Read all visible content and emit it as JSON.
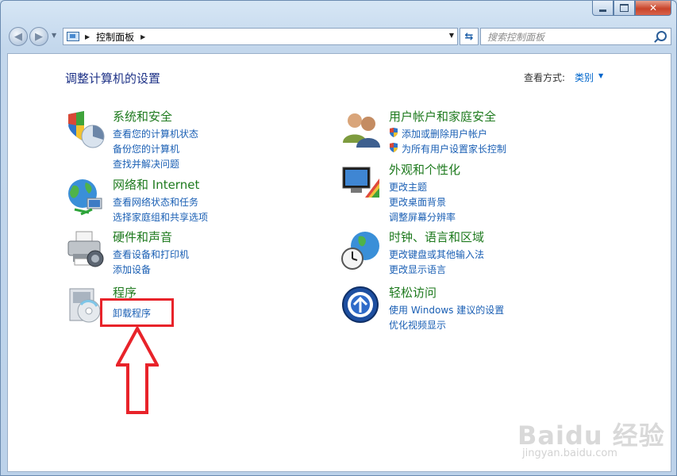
{
  "window": {
    "controls": {
      "minimize": "—",
      "maximize": "□",
      "close": "✕"
    }
  },
  "toolbar": {
    "breadcrumb": [
      "控制面板"
    ],
    "search_placeholder": "搜索控制面板"
  },
  "header": {
    "title": "调整计算机的设置",
    "view_by_label": "查看方式:",
    "view_by_value": "类别"
  },
  "categories": [
    {
      "title": "系统和安全",
      "links": [
        "查看您的计算机状态",
        "备份您的计算机",
        "查找并解决问题"
      ],
      "icon": "shield-icon"
    },
    {
      "title": "网络和 Internet",
      "links": [
        "查看网络状态和任务",
        "选择家庭组和共享选项"
      ],
      "icon": "globe-network-icon"
    },
    {
      "title": "硬件和声音",
      "links": [
        "查看设备和打印机",
        "添加设备"
      ],
      "icon": "printer-icon"
    },
    {
      "title": "程序",
      "links": [
        "卸载程序"
      ],
      "icon": "programs-cd-icon"
    },
    {
      "title": "用户帐户和家庭安全",
      "links": [
        "添加或删除用户帐户",
        "为所有用户设置家长控制"
      ],
      "icon": "users-icon"
    },
    {
      "title": "外观和个性化",
      "links": [
        "更改主题",
        "更改桌面背景",
        "调整屏幕分辨率"
      ],
      "icon": "monitor-paint-icon"
    },
    {
      "title": "时钟、语言和区域",
      "links": [
        "更改键盘或其他输入法",
        "更改显示语言"
      ],
      "icon": "clock-globe-icon"
    },
    {
      "title": "轻松访问",
      "links": [
        "使用 Windows 建议的设置",
        "优化视频显示"
      ],
      "icon": "ease-of-access-icon"
    }
  ],
  "annotation": {
    "color": "#e8232a",
    "target": "卸载程序"
  },
  "watermark": {
    "brand": "Baidu 经验",
    "url": "jingyan.baidu.com"
  }
}
